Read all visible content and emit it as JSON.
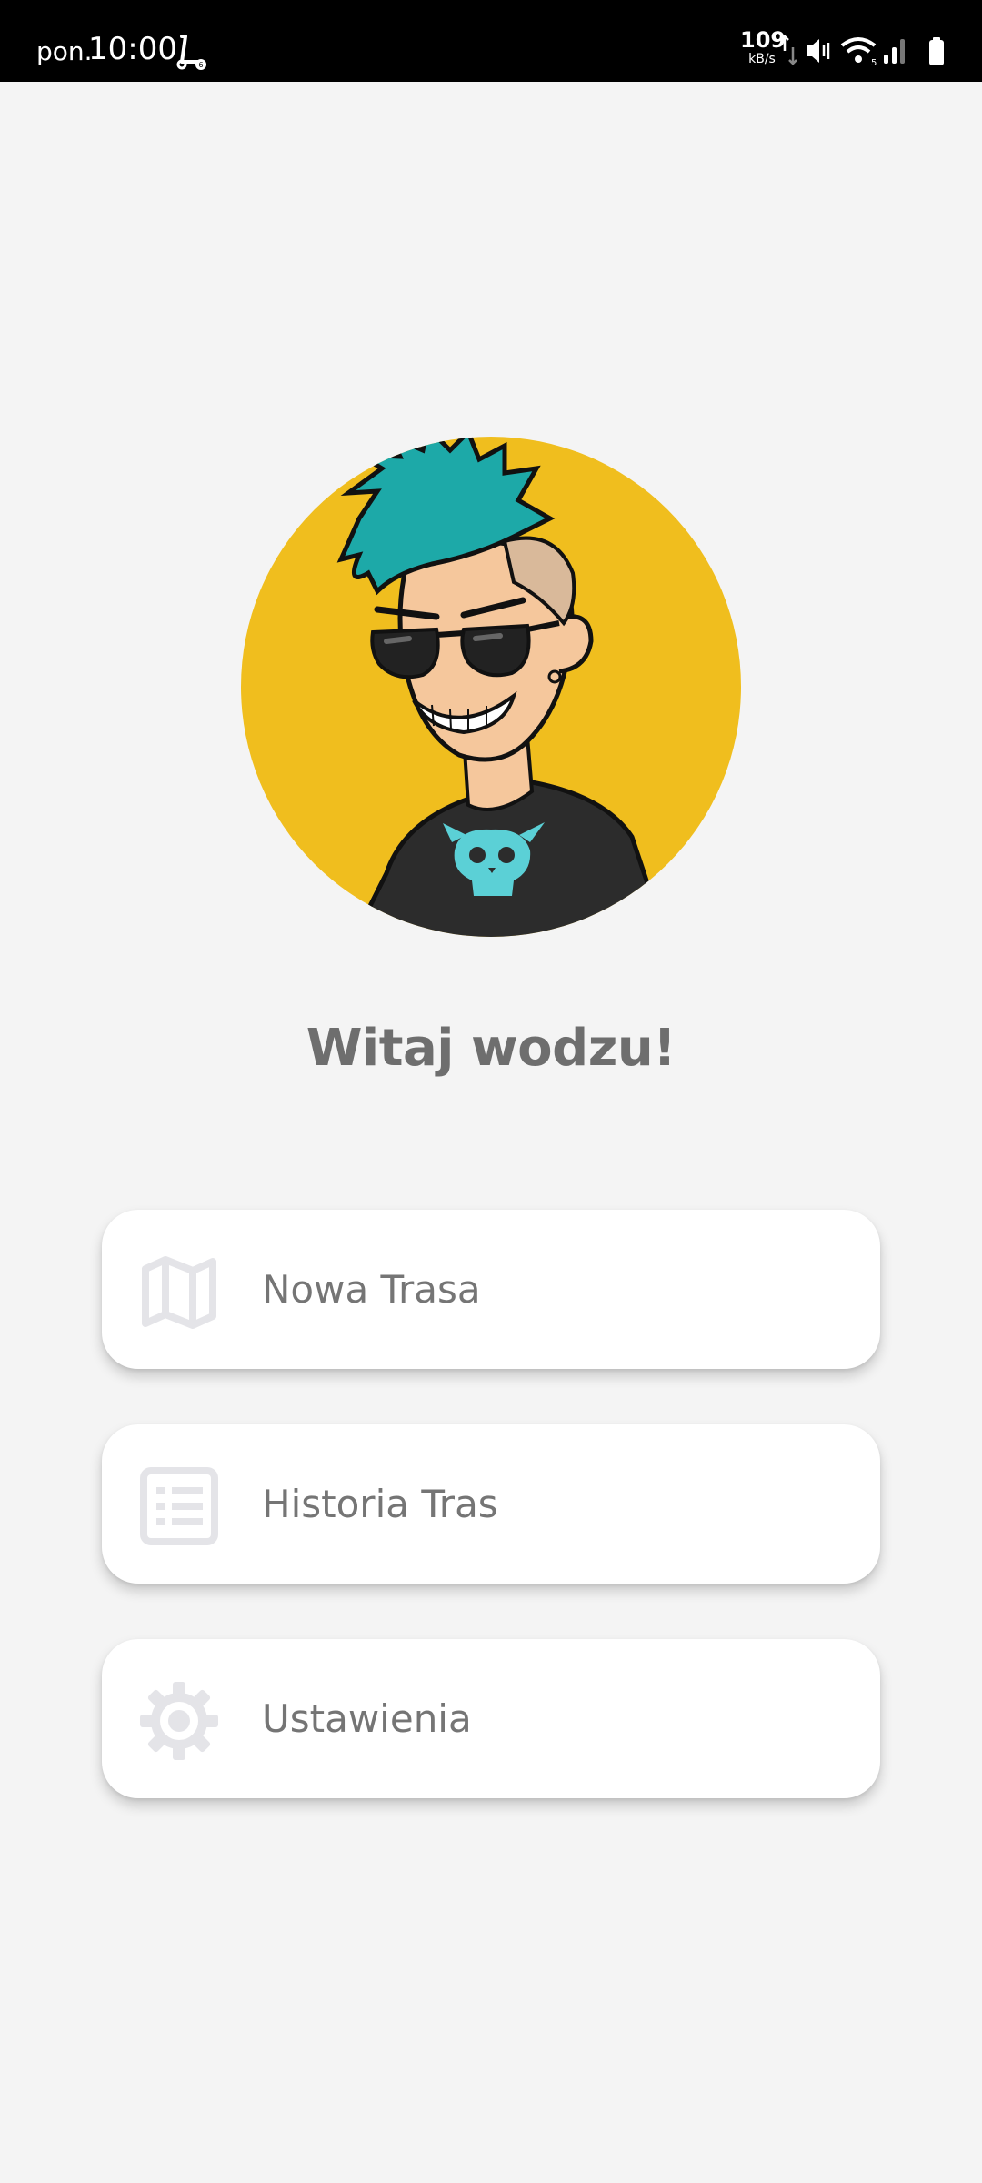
{
  "status_bar": {
    "day": "pon.",
    "time": "10:00",
    "net_speed_value": "109",
    "net_speed_unit": "kB/s",
    "icons": [
      "scooter-icon",
      "data-arrows-icon",
      "vibrate-icon",
      "wifi-icon",
      "signal-icon",
      "battery-icon"
    ]
  },
  "avatar": {
    "description_icon": "punk-avatar",
    "background_color": "#F0BE1E"
  },
  "welcome": {
    "title": "Witaj wodzu!"
  },
  "menu": {
    "items": [
      {
        "label": "Nowa Trasa",
        "icon": "map-icon"
      },
      {
        "label": "Historia Tras",
        "icon": "list-icon"
      },
      {
        "label": "Ustawienia",
        "icon": "gear-icon"
      }
    ]
  },
  "colors": {
    "background": "#f4f4f4",
    "card": "#ffffff",
    "text": "#757575",
    "icon": "#e4e4e8"
  }
}
